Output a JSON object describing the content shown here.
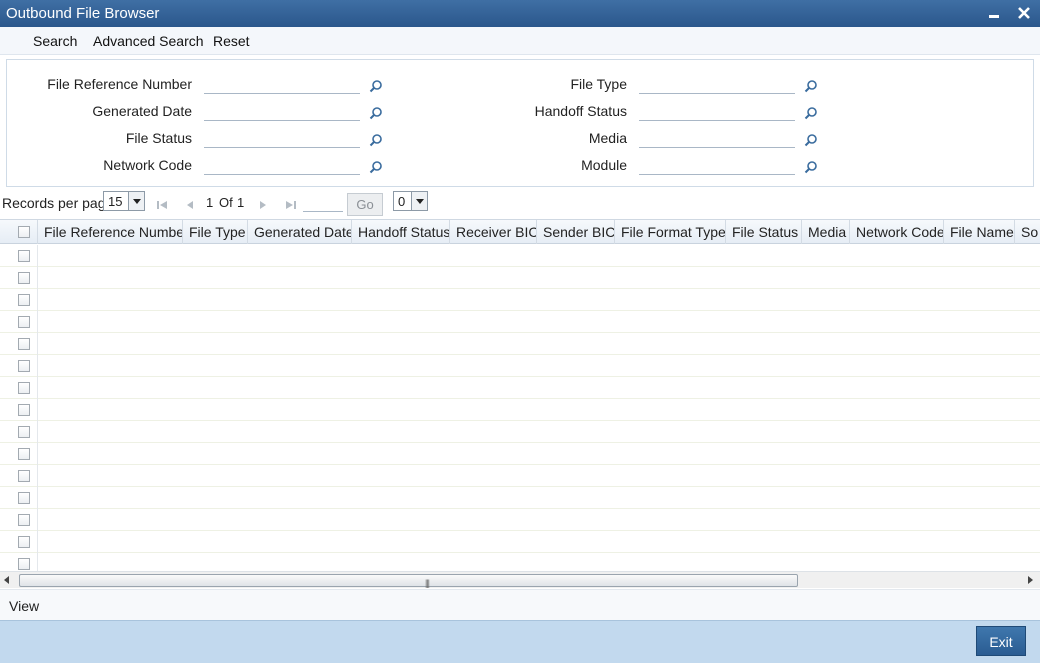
{
  "window": {
    "title": "Outbound File Browser",
    "minimize_icon": "minimize-icon",
    "close_icon": "close-icon"
  },
  "toolbar": {
    "search": "Search",
    "advanced_search": "Advanced Search",
    "reset": "Reset"
  },
  "criteria": {
    "left": [
      {
        "label": "File Reference Number",
        "value": ""
      },
      {
        "label": "Generated Date",
        "value": ""
      },
      {
        "label": "File Status",
        "value": ""
      },
      {
        "label": "Network Code",
        "value": ""
      }
    ],
    "right": [
      {
        "label": "File Type",
        "value": ""
      },
      {
        "label": "Handoff Status",
        "value": ""
      },
      {
        "label": "Media",
        "value": ""
      },
      {
        "label": "Module",
        "value": ""
      }
    ],
    "lov_icon": "search-icon"
  },
  "pager": {
    "records_label": "Records per page",
    "records_value": "15",
    "current_page": "1",
    "of_label": "Of",
    "total_pages": "1",
    "go_label": "Go",
    "page_input": "",
    "extra_select_value": "0"
  },
  "grid": {
    "columns": [
      "File Reference Number",
      "File Type",
      "Generated Date",
      "Handoff Status",
      "Receiver BIC",
      "Sender BIC",
      "File Format Type",
      "File Status",
      "Media",
      "Network Code",
      "File Name",
      "So"
    ],
    "row_count": 15
  },
  "view": {
    "label": "View"
  },
  "footer": {
    "exit": "Exit"
  },
  "colors": {
    "title_bar": "#2b578c",
    "footer": "#c2d9ee",
    "exit_button": "#2a5c92"
  }
}
